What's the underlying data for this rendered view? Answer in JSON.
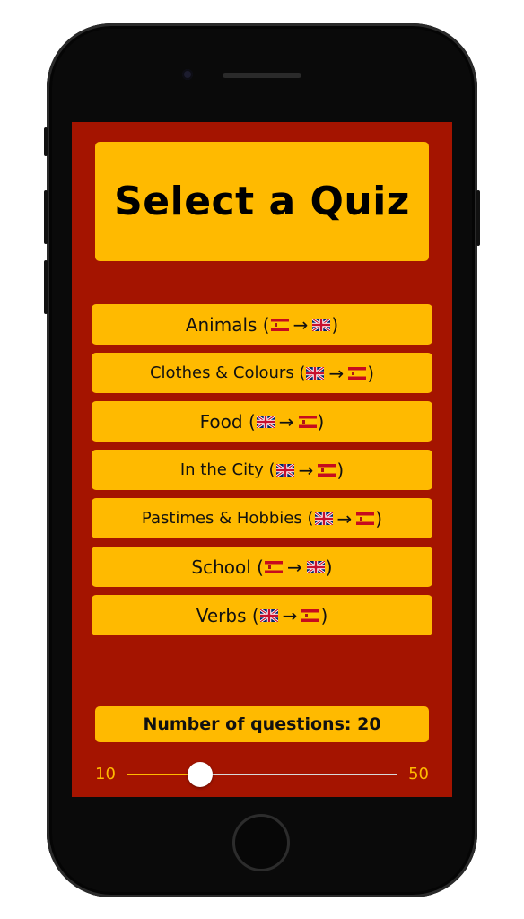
{
  "title": "Select a Quiz",
  "quizzes": [
    {
      "label": "Animals (",
      "from": "es-flag-icon",
      "to": "gb-flag-icon"
    },
    {
      "label": "Clothes & Colours (",
      "from": "gb-flag-icon",
      "to": "es-flag-icon"
    },
    {
      "label": "Food (",
      "from": "gb-flag-icon",
      "to": "es-flag-icon"
    },
    {
      "label": "In the City (",
      "from": "gb-flag-icon",
      "to": "es-flag-icon"
    },
    {
      "label": "Pastimes & Hobbies (",
      "from": "gb-flag-icon",
      "to": "es-flag-icon"
    },
    {
      "label": "School (",
      "from": "es-flag-icon",
      "to": "gb-flag-icon"
    },
    {
      "label": "Verbs (",
      "from": "gb-flag-icon",
      "to": "es-flag-icon"
    }
  ],
  "arrow": "→",
  "close_paren": ")",
  "question_count": {
    "label": "Number of questions: 20",
    "value": 20
  },
  "slider": {
    "min_label": "10",
    "max_label": "50",
    "min": 10,
    "max": 50,
    "value": 20
  },
  "colors": {
    "background": "#a41400",
    "accent": "#ffba00",
    "phone": "#0a0a0a"
  }
}
